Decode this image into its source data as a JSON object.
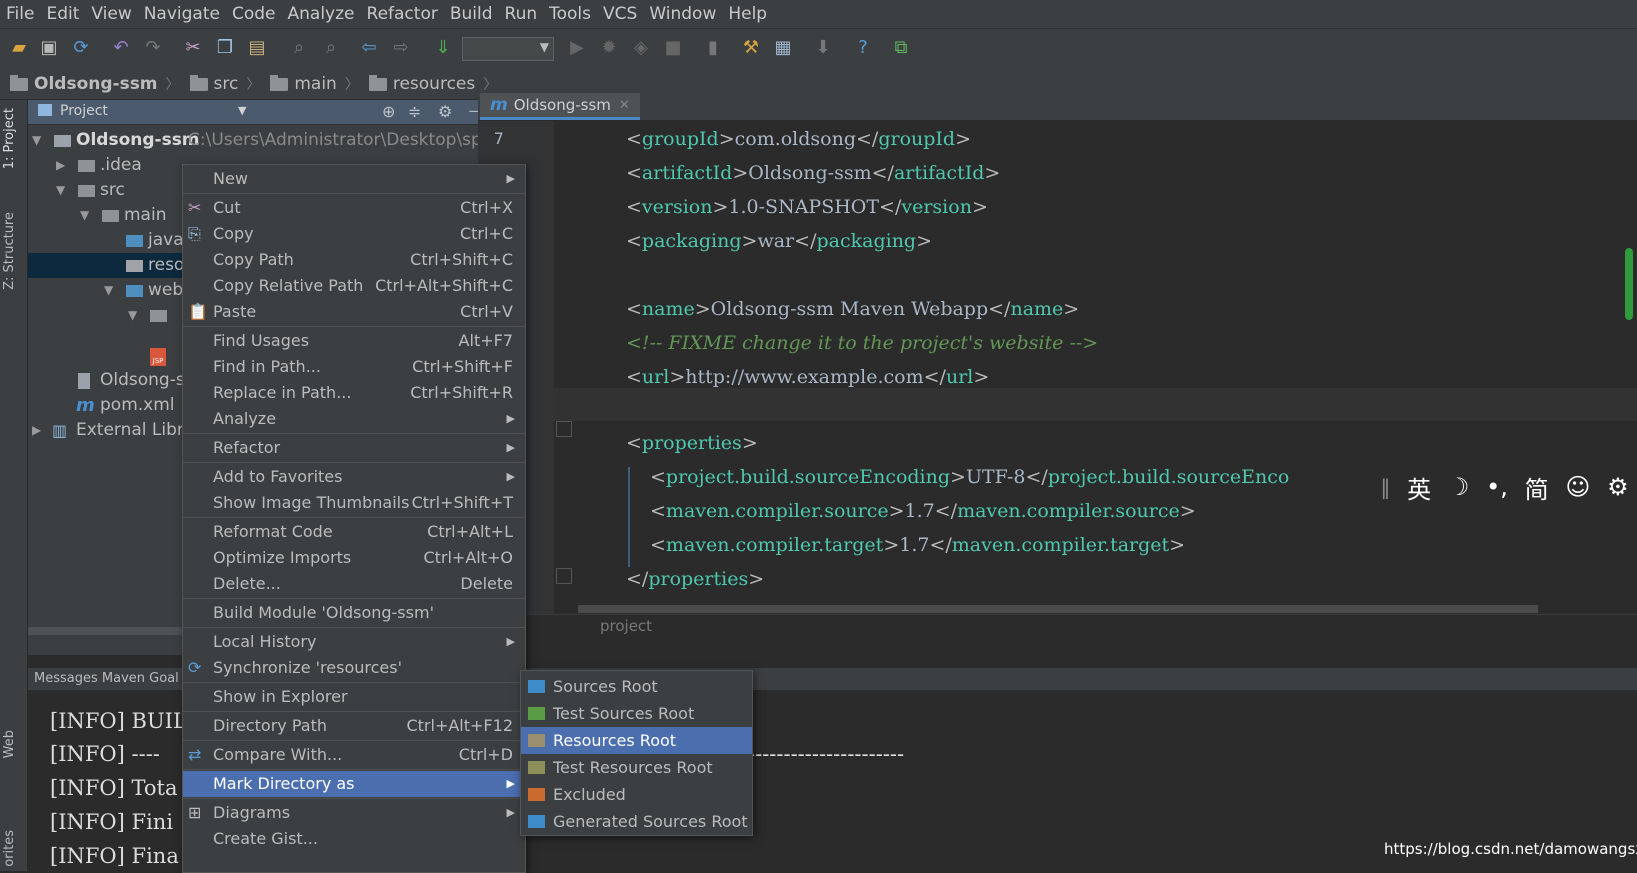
{
  "menubar": [
    "File",
    "Edit",
    "View",
    "Navigate",
    "Code",
    "Analyze",
    "Refactor",
    "Build",
    "Run",
    "Tools",
    "VCS",
    "Window",
    "Help"
  ],
  "toolbar": {
    "icons": [
      "open-icon",
      "save-icon",
      "sync-icon",
      "undo-icon",
      "redo-icon",
      "cut-icon",
      "copy-icon",
      "paste-icon",
      "find-icon",
      "replace-icon",
      "back-icon",
      "forward-icon",
      "make-icon",
      "run-config-dropdown",
      "run-icon",
      "debug-icon",
      "coverage-icon",
      "stop-icon",
      "vcs-icon",
      "settings-icon",
      "project-structure-icon",
      "sdk-icon",
      "help-icon",
      "plugins-icon"
    ]
  },
  "breadcrumb": [
    "Oldsong-ssm",
    "src",
    "main",
    "resources"
  ],
  "left_stripe": {
    "project": "1: Project",
    "structure": "Z: Structure",
    "web": "Web",
    "favorites": "orites"
  },
  "project_panel": {
    "title": "Project",
    "tree": [
      {
        "label": "Oldsong-ssm",
        "path": "C:\\Users\\Administrator\\Desktop\\springr"
      },
      {
        "label": ".idea"
      },
      {
        "label": "src"
      },
      {
        "label": "main"
      },
      {
        "label": "java"
      },
      {
        "label": "reso"
      },
      {
        "label": "web"
      },
      {
        "label": ""
      },
      {
        "label": "Oldsong-s"
      },
      {
        "label": "pom.xml"
      },
      {
        "label": "External Libra"
      }
    ]
  },
  "editor": {
    "tab": "Oldsong-ssm",
    "first_line_number": "7",
    "lines": {
      "l1": [
        "<",
        "groupId",
        ">",
        "com.oldsong",
        "</",
        "groupId",
        ">"
      ],
      "l2": [
        "<",
        "artifactId",
        ">",
        "Oldsong-ssm",
        "</",
        "artifactId",
        ">"
      ],
      "l3": [
        "<",
        "version",
        ">",
        "1.0-SNAPSHOT",
        "</",
        "version",
        ">"
      ],
      "l4": [
        "<",
        "packaging",
        ">",
        "war",
        "</",
        "packaging",
        ">"
      ],
      "l6": [
        "<",
        "name",
        ">",
        "Oldsong-ssm Maven Webapp",
        "</",
        "name",
        ">"
      ],
      "l7": "<!-- FIXME change it to the project's website -->",
      "l8": [
        "<",
        "url",
        ">",
        "http://www.example.com",
        "</",
        "url",
        ">"
      ],
      "l10": [
        "<",
        "properties",
        ">"
      ],
      "l11": [
        "<",
        "project.build.sourceEncoding",
        ">",
        "UTF-8",
        "</",
        "project.build.sourceEnco"
      ],
      "l12": [
        "<",
        "maven.compiler.source",
        ">",
        "1.7",
        "</",
        "maven.compiler.source",
        ">"
      ],
      "l13": [
        "<",
        "maven.compiler.target",
        ">",
        "1.7",
        "</",
        "maven.compiler.target",
        ">"
      ],
      "l14": [
        "</",
        "properties",
        ">"
      ]
    },
    "breadcrumb": "project"
  },
  "ime": {
    "lang": "英",
    "moon": "☽",
    "punct": "•,",
    "simp": "简",
    "emoji": "☺",
    "gear": "⚙"
  },
  "messages": {
    "title": "Messages Maven Goal",
    "lines": [
      "[INFO] BUIL",
      "[INFO] ----",
      "[INFO] Tota",
      "[INFO] Fini",
      "[INFO] Fina"
    ],
    "dashes": "----------------------"
  },
  "context_menu": [
    {
      "label": "New",
      "shortcut": "",
      "submenu": true
    },
    {
      "label": "Cut",
      "shortcut": "Ctrl+X",
      "icon": "✂"
    },
    {
      "label": "Copy",
      "shortcut": "Ctrl+C",
      "icon": "⎘"
    },
    {
      "label": "Copy Path",
      "shortcut": "Ctrl+Shift+C"
    },
    {
      "label": "Copy Relative Path",
      "shortcut": "Ctrl+Alt+Shift+C"
    },
    {
      "label": "Paste",
      "shortcut": "Ctrl+V",
      "icon": "📋"
    },
    {
      "label": "Find Usages",
      "shortcut": "Alt+F7"
    },
    {
      "label": "Find in Path...",
      "shortcut": "Ctrl+Shift+F"
    },
    {
      "label": "Replace in Path...",
      "shortcut": "Ctrl+Shift+R"
    },
    {
      "label": "Analyze",
      "shortcut": "",
      "submenu": true
    },
    {
      "label": "Refactor",
      "shortcut": "",
      "submenu": true
    },
    {
      "label": "Add to Favorites",
      "shortcut": "",
      "submenu": true
    },
    {
      "label": "Show Image Thumbnails",
      "shortcut": "Ctrl+Shift+T"
    },
    {
      "label": "Reformat Code",
      "shortcut": "Ctrl+Alt+L"
    },
    {
      "label": "Optimize Imports",
      "shortcut": "Ctrl+Alt+O"
    },
    {
      "label": "Delete...",
      "shortcut": "Delete"
    },
    {
      "label": "Build Module 'Oldsong-ssm'",
      "shortcut": ""
    },
    {
      "label": "Local History",
      "shortcut": "",
      "submenu": true
    },
    {
      "label": "Synchronize 'resources'",
      "shortcut": "",
      "icon": "⟳"
    },
    {
      "label": "Show in Explorer",
      "shortcut": ""
    },
    {
      "label": "Directory Path",
      "shortcut": "Ctrl+Alt+F12"
    },
    {
      "label": "Compare With...",
      "shortcut": "Ctrl+D",
      "icon": "⇄"
    },
    {
      "label": "Mark Directory as",
      "shortcut": "",
      "submenu": true
    },
    {
      "label": "Diagrams",
      "shortcut": "",
      "submenu": true,
      "icon": "⊞"
    },
    {
      "label": "Create Gist...",
      "shortcut": ""
    }
  ],
  "submenu": [
    {
      "label": "Sources Root",
      "color": "#3d8bc9"
    },
    {
      "label": "Test Sources Root",
      "color": "#5a9c45"
    },
    {
      "label": "Resources Root",
      "color": "#9a8f6e"
    },
    {
      "label": "Test Resources Root",
      "color": "#8c8f5a"
    },
    {
      "label": "Excluded",
      "color": "#c96b2e"
    },
    {
      "label": "Generated Sources Root",
      "color": "#3d8bc9"
    }
  ],
  "watermark": "https://blog.csdn.net/damowangsx",
  "colors": {
    "highlight": "#4b6eaf",
    "tag": "#e8bf6a",
    "tag_name": "#4ec9b0",
    "comment": "#629755",
    "selection": "#0d293e"
  }
}
